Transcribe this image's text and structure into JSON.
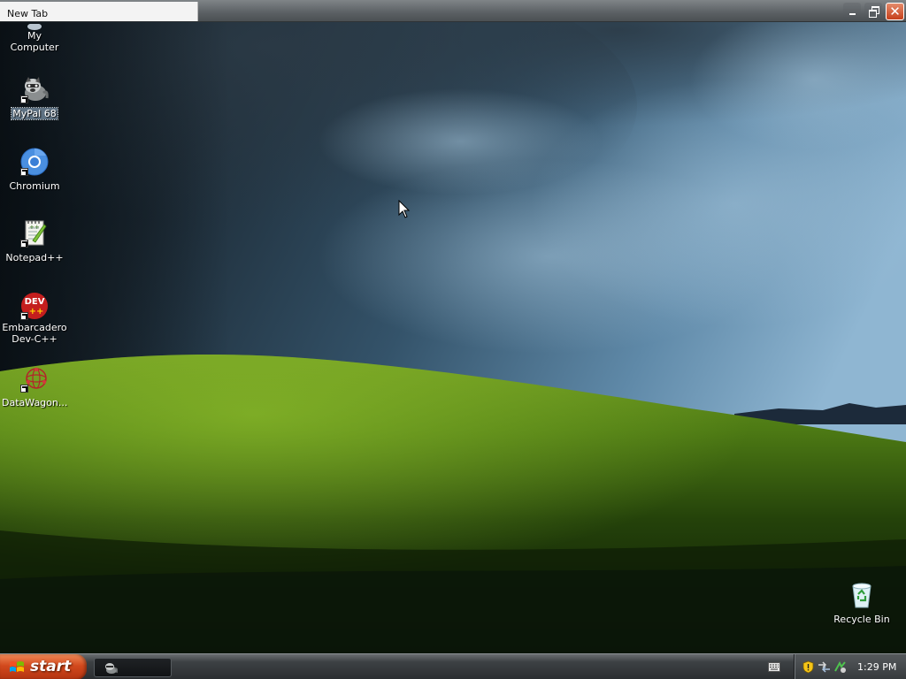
{
  "browser": {
    "tab_title": "New Tab",
    "close_glyph": "✕"
  },
  "desktop": {
    "icons": [
      {
        "label": "My Computer",
        "icon": "computer-icon"
      },
      {
        "label": "MyPal 68",
        "icon": "mypal-icon",
        "shortcut": true,
        "selected": true
      },
      {
        "label": "Chromium",
        "icon": "chromium-icon",
        "shortcut": true
      },
      {
        "label": "Notepad++",
        "icon": "notepad-plus-plus-icon",
        "shortcut": true
      },
      {
        "label": "Embarcadero\nDev-C++",
        "icon": "dev-cpp-icon",
        "shortcut": true
      },
      {
        "label": "DataWagon...",
        "icon": "datawagon-icon",
        "shortcut": true
      },
      {
        "label": "Recycle Bin",
        "icon": "recycle-bin-icon"
      }
    ],
    "dev_icon_text": "DEV",
    "dev_icon_subtext": "++"
  },
  "taskbar": {
    "start_label": "start",
    "clock": "1:29 PM"
  },
  "colors": {
    "taskbar": "#2f3336",
    "start": "#d2491d",
    "tab": "#f3f3f3"
  }
}
